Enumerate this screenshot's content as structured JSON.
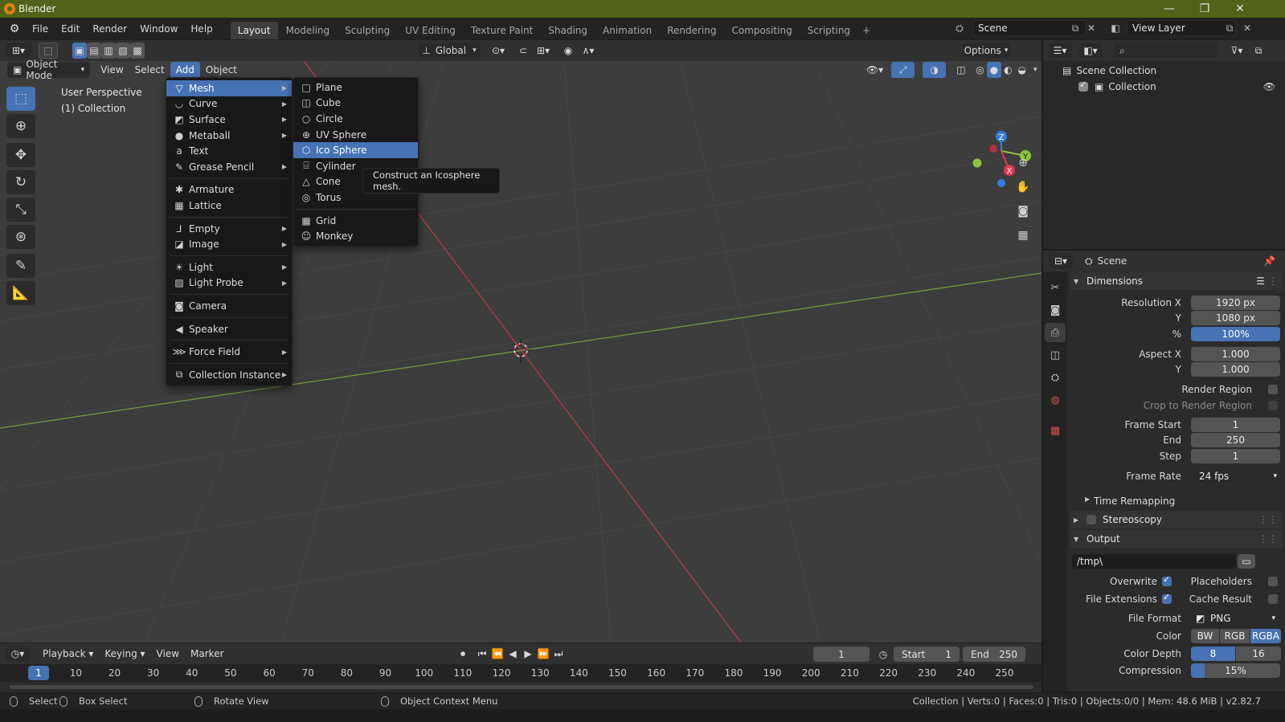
{
  "window": {
    "title": "Blender",
    "controls": [
      "—",
      "❐",
      "✕"
    ]
  },
  "topmenu": [
    "File",
    "Edit",
    "Render",
    "Window",
    "Help"
  ],
  "workspaces": [
    "Layout",
    "Modeling",
    "Sculpting",
    "UV Editing",
    "Texture Paint",
    "Shading",
    "Animation",
    "Rendering",
    "Compositing",
    "Scripting"
  ],
  "workspace_add": "+",
  "scene_name": "Scene",
  "view_layer": "View Layer",
  "viewport": {
    "mode": "Object Mode",
    "menus": [
      "View",
      "Select",
      "Add",
      "Object"
    ],
    "orientation": "Global",
    "options_label": "Options",
    "perspective": "User Perspective",
    "collection_label": "(1) Collection"
  },
  "add_menu": {
    "items": [
      {
        "label": "Mesh",
        "icon": "mesh-icon",
        "glyph": "▽",
        "sub": true,
        "active": true
      },
      {
        "label": "Curve",
        "icon": "curve-icon",
        "glyph": "◡",
        "sub": true
      },
      {
        "label": "Surface",
        "icon": "surface-icon",
        "glyph": "◩",
        "sub": true
      },
      {
        "label": "Metaball",
        "icon": "metaball-icon",
        "glyph": "●",
        "sub": true
      },
      {
        "label": "Text",
        "icon": "text-icon",
        "glyph": "a",
        "sub": false
      },
      {
        "label": "Grease Pencil",
        "icon": "grease-pencil-icon",
        "glyph": "✎",
        "sub": true
      },
      {
        "sep": true
      },
      {
        "label": "Armature",
        "icon": "armature-icon",
        "glyph": "✱",
        "sub": false
      },
      {
        "label": "Lattice",
        "icon": "lattice-icon",
        "glyph": "▦",
        "sub": false
      },
      {
        "sep": true
      },
      {
        "label": "Empty",
        "icon": "empty-icon",
        "glyph": "⅃",
        "sub": true
      },
      {
        "label": "Image",
        "icon": "image-icon",
        "glyph": "◪",
        "sub": true
      },
      {
        "sep": true
      },
      {
        "label": "Light",
        "icon": "light-icon",
        "glyph": "☀",
        "sub": true
      },
      {
        "label": "Light Probe",
        "icon": "light-probe-icon",
        "glyph": "▨",
        "sub": true
      },
      {
        "sep": true
      },
      {
        "label": "Camera",
        "icon": "camera-icon",
        "glyph": "◙",
        "sub": false
      },
      {
        "sep": true
      },
      {
        "label": "Speaker",
        "icon": "speaker-icon",
        "glyph": "◀",
        "sub": false
      },
      {
        "sep": true
      },
      {
        "label": "Force Field",
        "icon": "force-field-icon",
        "glyph": "⋙",
        "sub": true
      },
      {
        "sep": true
      },
      {
        "label": "Collection Instance",
        "icon": "collection-instance-icon",
        "glyph": "⧉",
        "sub": true
      }
    ]
  },
  "mesh_menu": {
    "items": [
      {
        "label": "Plane",
        "icon": "plane-icon",
        "glyph": "□"
      },
      {
        "label": "Cube",
        "icon": "cube-icon",
        "glyph": "◫"
      },
      {
        "label": "Circle",
        "icon": "circle-icon",
        "glyph": "○"
      },
      {
        "label": "UV Sphere",
        "icon": "uv-sphere-icon",
        "glyph": "⊕"
      },
      {
        "label": "Ico Sphere",
        "icon": "ico-sphere-icon",
        "glyph": "⬡",
        "active": true
      },
      {
        "label": "Cylinder",
        "icon": "cylinder-icon",
        "glyph": "⌸"
      },
      {
        "label": "Cone",
        "icon": "cone-icon",
        "glyph": "△"
      },
      {
        "label": "Torus",
        "icon": "torus-icon",
        "glyph": "◎"
      },
      {
        "sep": true
      },
      {
        "label": "Grid",
        "icon": "grid-icon",
        "glyph": "▦"
      },
      {
        "label": "Monkey",
        "icon": "monkey-icon",
        "glyph": "☺"
      }
    ]
  },
  "tooltip": "Construct an Icosphere mesh.",
  "gizmo": {
    "z": "Z",
    "y": "Y",
    "x": "X"
  },
  "timeline": {
    "menus": [
      "Playback",
      "Keying",
      "View",
      "Marker"
    ],
    "current_frame": "1",
    "start_label": "Start",
    "start": "1",
    "end_label": "End",
    "end": "250",
    "ticks": [
      "10",
      "20",
      "30",
      "40",
      "50",
      "60",
      "70",
      "80",
      "90",
      "100",
      "110",
      "120",
      "130",
      "140",
      "150",
      "160",
      "170",
      "180",
      "190",
      "200",
      "210",
      "220",
      "230",
      "240",
      "250"
    ]
  },
  "statusbar": {
    "select": "Select",
    "box_select": "Box Select",
    "rotate_view": "Rotate View",
    "context_menu": "Object Context Menu",
    "stats": "Collection | Verts:0 | Faces:0 | Tris:0 | Objects:0/0 | Mem: 48.6 MiB | v2.82.7"
  },
  "outliner": {
    "scene_collection": "Scene Collection",
    "collection": "Collection"
  },
  "properties": {
    "context": "Scene",
    "dimensions": {
      "title": "Dimensions",
      "resolution_x_label": "Resolution X",
      "resolution_x": "1920 px",
      "y_label": "Y",
      "resolution_y": "1080 px",
      "percent_label": "%",
      "percent": "100%",
      "aspect_x_label": "Aspect X",
      "aspect_x": "1.000",
      "aspect_y_label": "Y",
      "aspect_y": "1.000",
      "render_region": "Render Region",
      "crop": "Crop to Render Region",
      "frame_start_label": "Frame Start",
      "frame_start": "1",
      "end_label": "End",
      "frame_end": "250",
      "step_label": "Step",
      "step": "1",
      "frame_rate_label": "Frame Rate",
      "frame_rate": "24 fps",
      "time_remapping": "Time Remapping"
    },
    "stereoscopy": "Stereoscopy",
    "output": {
      "title": "Output",
      "path": "/tmp\\",
      "overwrite": "Overwrite",
      "placeholders": "Placeholders",
      "file_extensions": "File Extensions",
      "cache_result": "Cache Result",
      "file_format_label": "File Format",
      "file_format": "PNG",
      "color_label": "Color",
      "color_options": [
        "BW",
        "RGB",
        "RGBA"
      ],
      "color_depth_label": "Color Depth",
      "depth_options": [
        "8",
        "16"
      ],
      "compression_label": "Compression",
      "compression": "15%"
    }
  },
  "colors": {
    "accent": "#4772b3",
    "titlebar": "#4f6419",
    "x_axis": "#e0384c",
    "y_axis": "#8cc53f",
    "z_axis": "#2f7fe0"
  }
}
